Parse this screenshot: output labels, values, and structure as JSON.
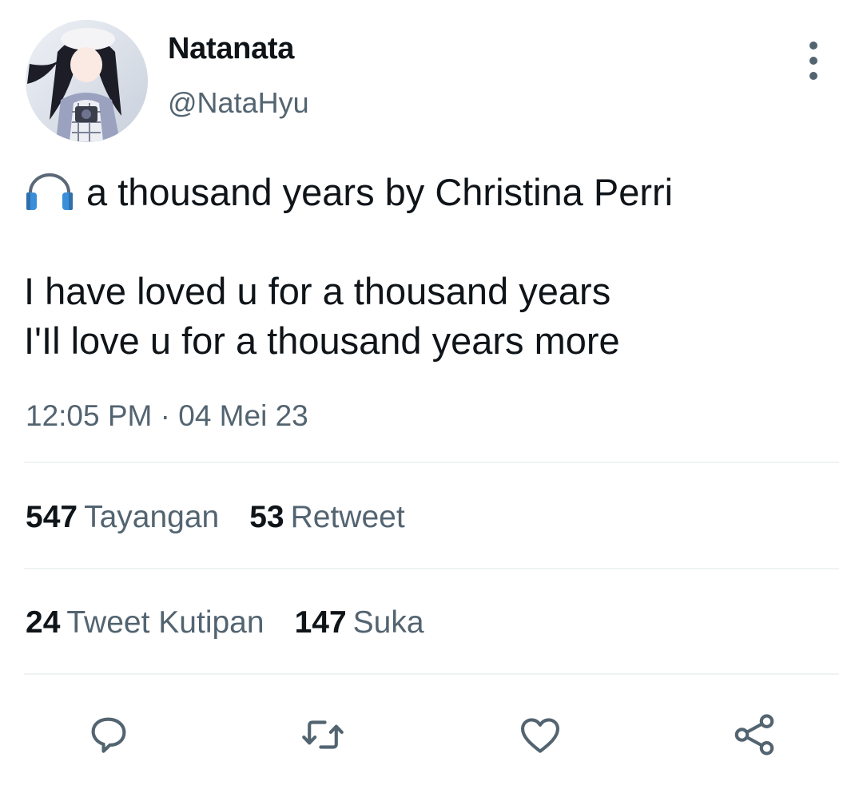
{
  "author": {
    "display_name": "Natanata",
    "handle": "@NataHyu"
  },
  "tweet": {
    "emoji_icon": "headphone-icon",
    "line1": "a thousand years by Christina Perri",
    "line2": "I have loved u for a thousand years",
    "line3": "I'Il love u for a thousand years more",
    "timestamp": "12:05 PM · 04 Mei 23"
  },
  "stats": {
    "views_count": "547",
    "views_label": "Tayangan",
    "retweets_count": "53",
    "retweets_label": "Retweet",
    "quotes_count": "24",
    "quotes_label": "Tweet Kutipan",
    "likes_count": "147",
    "likes_label": "Suka"
  },
  "actions": [
    "reply-icon",
    "retweet-icon",
    "like-icon",
    "share-icon"
  ],
  "colors": {
    "text_primary": "#0f1419",
    "text_secondary": "#536471",
    "divider": "#eff3f4"
  }
}
